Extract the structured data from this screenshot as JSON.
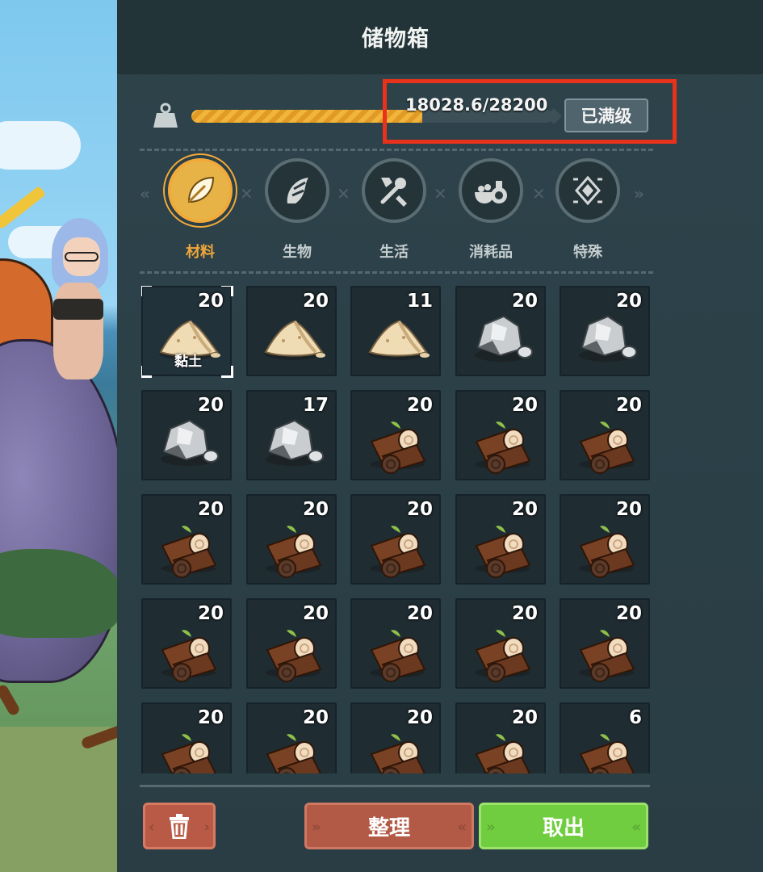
{
  "window": {
    "title": "储物箱"
  },
  "capacity": {
    "text": "18028.6/28200",
    "fraction": 0.6393,
    "level_button": "已满级"
  },
  "tabs": [
    {
      "label": "材料",
      "icon": "leaf-icon",
      "active": true
    },
    {
      "label": "生物",
      "icon": "creature-claw-icon",
      "active": false
    },
    {
      "label": "生活",
      "icon": "tools-icon",
      "active": false
    },
    {
      "label": "消耗品",
      "icon": "potion-food-icon",
      "active": false
    },
    {
      "label": "特殊",
      "icon": "special-gem-icon",
      "active": false
    }
  ],
  "items": [
    {
      "type": "clay",
      "qty": "20",
      "name": "黏土",
      "selected": true
    },
    {
      "type": "clay",
      "qty": "20"
    },
    {
      "type": "clay",
      "qty": "11"
    },
    {
      "type": "stone",
      "qty": "20"
    },
    {
      "type": "stone",
      "qty": "20"
    },
    {
      "type": "stone",
      "qty": "20"
    },
    {
      "type": "stone",
      "qty": "17"
    },
    {
      "type": "wood",
      "qty": "20"
    },
    {
      "type": "wood",
      "qty": "20"
    },
    {
      "type": "wood",
      "qty": "20"
    },
    {
      "type": "wood",
      "qty": "20"
    },
    {
      "type": "wood",
      "qty": "20"
    },
    {
      "type": "wood",
      "qty": "20"
    },
    {
      "type": "wood",
      "qty": "20"
    },
    {
      "type": "wood",
      "qty": "20"
    },
    {
      "type": "wood",
      "qty": "20"
    },
    {
      "type": "wood",
      "qty": "20"
    },
    {
      "type": "wood",
      "qty": "20"
    },
    {
      "type": "wood",
      "qty": "20"
    },
    {
      "type": "wood",
      "qty": "20"
    },
    {
      "type": "wood",
      "qty": "20"
    },
    {
      "type": "wood",
      "qty": "20"
    },
    {
      "type": "wood",
      "qty": "20"
    },
    {
      "type": "wood",
      "qty": "20"
    },
    {
      "type": "wood",
      "qty": "6"
    }
  ],
  "buttons": {
    "delete_icon": "trash-icon",
    "sort": "整理",
    "take_out": "取出"
  },
  "colors": {
    "accent": "#f0a63a",
    "take_out": "#6fcd3f",
    "sort": "#b35a47",
    "highlight": "#e8321c"
  }
}
